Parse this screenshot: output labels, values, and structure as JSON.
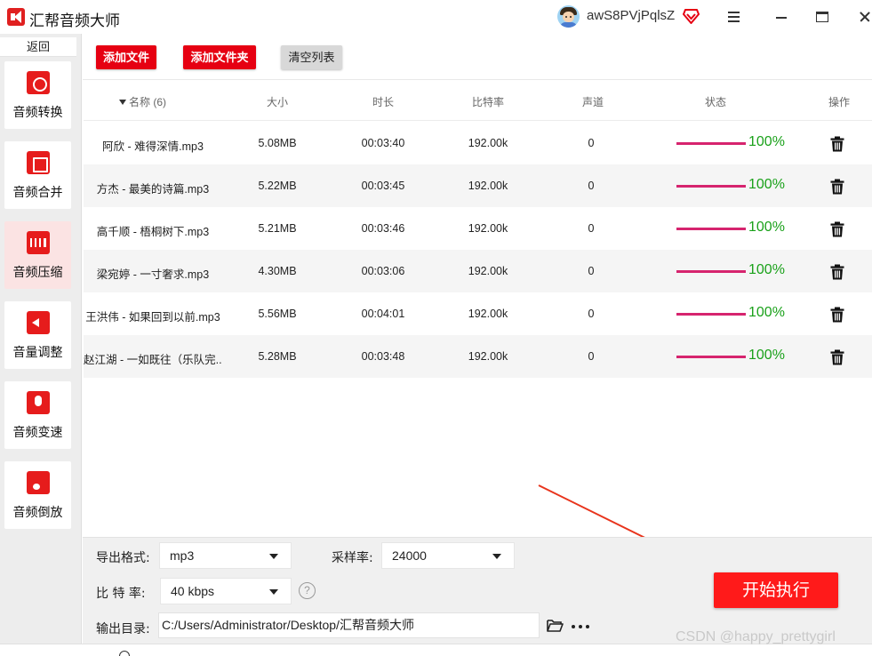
{
  "app": {
    "title": "汇帮音频大师"
  },
  "user": {
    "name": "awS8PVjPqlsZ"
  },
  "sidebar": {
    "back_label": "返回",
    "items": [
      {
        "label": "音频转换",
        "icon": "audio-convert-icon",
        "active": false
      },
      {
        "label": "音频合并",
        "icon": "audio-merge-icon",
        "active": false
      },
      {
        "label": "音频压缩",
        "icon": "audio-compress-icon",
        "active": true
      },
      {
        "label": "音量调整",
        "icon": "volume-adjust-icon",
        "active": false
      },
      {
        "label": "音频变速",
        "icon": "audio-speed-icon",
        "active": false
      },
      {
        "label": "音频倒放",
        "icon": "audio-reverse-icon",
        "active": false
      }
    ]
  },
  "toolbar": {
    "add_file": "添加文件",
    "add_folder": "添加文件夹",
    "clear_list": "清空列表"
  },
  "table": {
    "headers": {
      "name": "名称 (6)",
      "size": "大小",
      "duration": "时长",
      "bitrate": "比特率",
      "channel": "声道",
      "status": "状态",
      "action": "操作"
    },
    "rows": [
      {
        "name": "阿欣 - 难得深情.mp3",
        "size": "5.08MB",
        "duration": "00:03:40",
        "bitrate": "192.00k",
        "channel": "0",
        "progress": 100,
        "progress_text": "100%"
      },
      {
        "name": "方杰 - 最美的诗篇.mp3",
        "size": "5.22MB",
        "duration": "00:03:45",
        "bitrate": "192.00k",
        "channel": "0",
        "progress": 100,
        "progress_text": "100%"
      },
      {
        "name": "高千顺 - 梧桐树下.mp3",
        "size": "5.21MB",
        "duration": "00:03:46",
        "bitrate": "192.00k",
        "channel": "0",
        "progress": 100,
        "progress_text": "100%"
      },
      {
        "name": "梁宛婷 - 一寸奢求.mp3",
        "size": "4.30MB",
        "duration": "00:03:06",
        "bitrate": "192.00k",
        "channel": "0",
        "progress": 100,
        "progress_text": "100%"
      },
      {
        "name": "王洪伟 - 如果回到以前.mp3",
        "size": "5.56MB",
        "duration": "00:04:01",
        "bitrate": "192.00k",
        "channel": "0",
        "progress": 100,
        "progress_text": "100%"
      },
      {
        "name": "赵江湖 - 一如既往（乐队完...",
        "size": "5.28MB",
        "duration": "00:03:48",
        "bitrate": "192.00k",
        "channel": "0",
        "progress": 100,
        "progress_text": "100%"
      }
    ]
  },
  "settings": {
    "format_label": "导出格式:",
    "format_value": "mp3",
    "samplerate_label": "采样率:",
    "samplerate_value": "24000",
    "bitrate_label": "比 特 率:",
    "bitrate_value": "40 kbps",
    "help_glyph": "?",
    "output_label": "输出目录:",
    "output_path": "C:/Users/Administrator/Desktop/汇帮音频大师"
  },
  "start_button": "开始执行",
  "watermark": "CSDN @happy_prettygirl",
  "colors": {
    "accent_red": "#e60012",
    "progress_bar": "#d6246e",
    "progress_text": "#1aa11a"
  }
}
